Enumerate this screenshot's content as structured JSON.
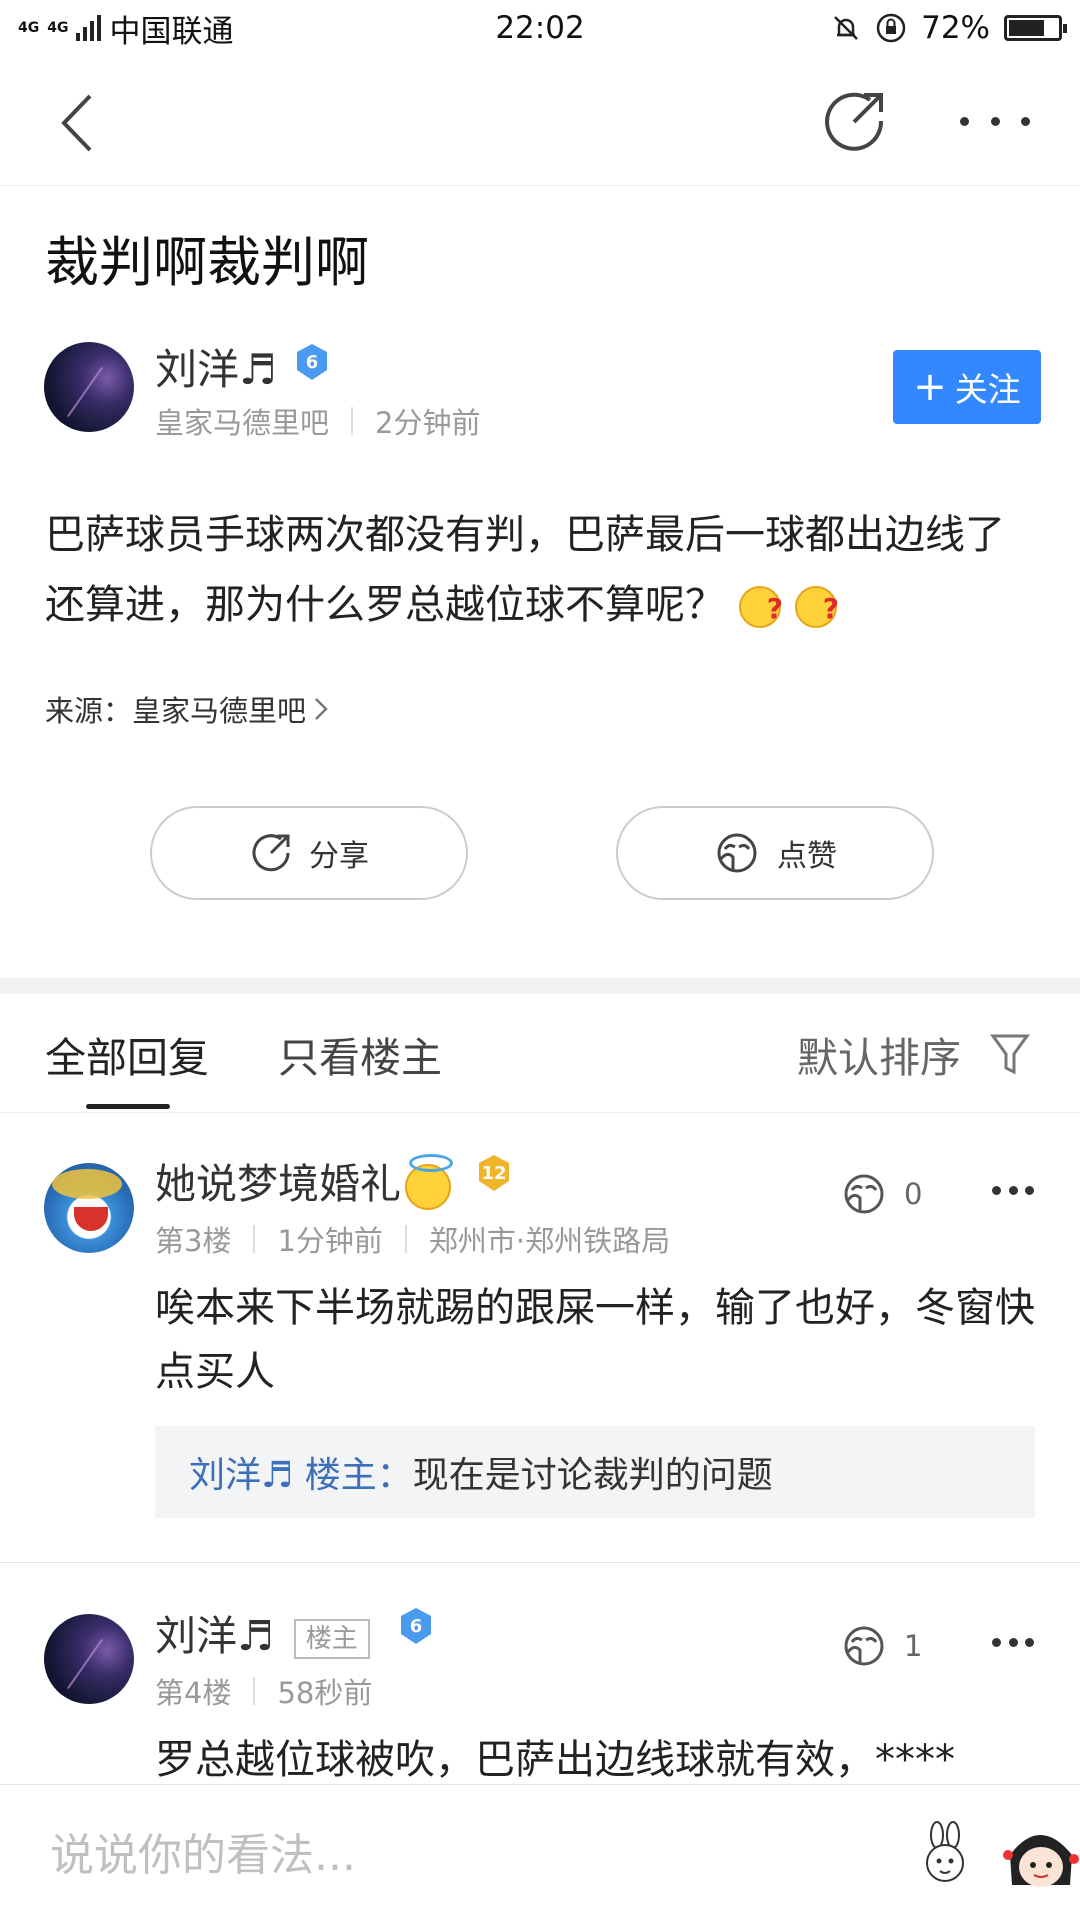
{
  "status_bar": {
    "network": "4G",
    "network2": "4G",
    "carrier": "中国联通",
    "time": "22:02",
    "battery": "72%",
    "battery_level": 0.72
  },
  "post": {
    "title": "裁判啊裁判啊",
    "author": {
      "name": "刘洋♬",
      "level": "6",
      "forum": "皇家马德里吧",
      "time": "2分钟前"
    },
    "follow_label": "关注",
    "body": "巴萨球员手球两次都没有判，巴萨最后一球都出边线了还算进，那为什么罗总越位球不算呢？",
    "source": "来源：皇家马德里吧",
    "share_label": "分享",
    "like_label": "点赞"
  },
  "tabs": {
    "all": "全部回复",
    "owner_only": "只看楼主",
    "sort": "默认排序"
  },
  "replies": [
    {
      "name": "她说梦境婚礼",
      "level": "12",
      "floor": "第3楼",
      "time": "1分钟前",
      "location": "郑州市·郑州铁路局",
      "likes": "0",
      "text": "唉本来下半场就踢的跟屎一样，输了也好，冬窗快点买人",
      "quote": {
        "who": "刘洋♬ 楼主：",
        "text": "现在是讨论裁判的问题"
      }
    },
    {
      "name": "刘洋♬",
      "owner_tag": "楼主",
      "level": "6",
      "floor": "第4楼",
      "time": "58秒前",
      "likes": "1",
      "text": "罗总越位球被吹，巴萨出边线球就有效，****"
    }
  ],
  "bottom_bar": {
    "placeholder": "说说你的看法..."
  },
  "colors": {
    "accent": "#3388ff",
    "quote_name": "#3b6fb8",
    "level_badge_blue": "#4a9af0",
    "level_badge_gold": "#f0b429"
  }
}
